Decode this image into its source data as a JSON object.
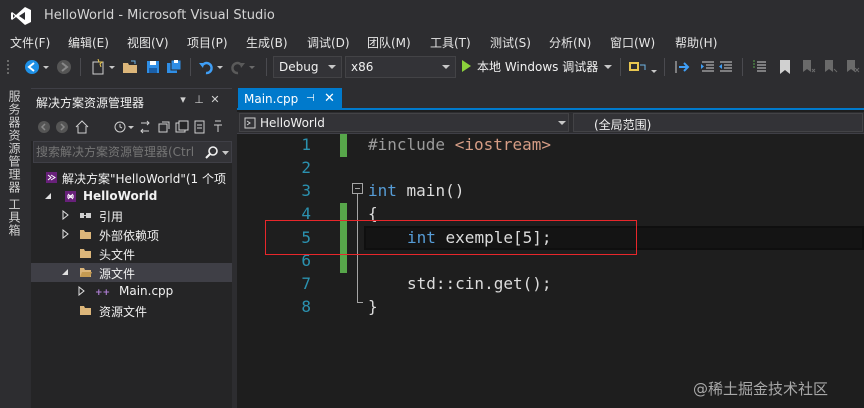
{
  "window": {
    "title": "HelloWorld - Microsoft Visual Studio"
  },
  "menu": [
    "文件(F)",
    "编辑(E)",
    "视图(V)",
    "项目(P)",
    "生成(B)",
    "调试(D)",
    "团队(M)",
    "工具(T)",
    "测试(S)",
    "分析(N)",
    "窗口(W)",
    "帮助(H)"
  ],
  "toolbar": {
    "config": "Debug",
    "platform": "x86",
    "run_label": "本地 Windows 调试器"
  },
  "left_tabs": [
    "服务器资源管理器",
    "工具箱"
  ],
  "solution_explorer": {
    "title": "解决方案资源管理器",
    "search_placeholder": "搜索解决方案资源管理器(Ctrl",
    "tree": [
      {
        "label": "解决方案\"HelloWorld\"(1 个项",
        "icon": "solution-icon",
        "expanded": true
      },
      {
        "label": "HelloWorld",
        "icon": "project-icon",
        "expanded": true,
        "bold": true
      },
      {
        "label": "引用",
        "icon": "references-icon",
        "expanded": false
      },
      {
        "label": "外部依赖项",
        "icon": "folder-icon",
        "expanded": false
      },
      {
        "label": "头文件",
        "icon": "folder-icon"
      },
      {
        "label": "源文件",
        "icon": "folder-icon",
        "expanded": true,
        "selected": true
      },
      {
        "label": "Main.cpp",
        "icon": "cpp-file-icon",
        "expanded": false
      },
      {
        "label": "资源文件",
        "icon": "folder-icon"
      }
    ]
  },
  "editor": {
    "tab": {
      "label": "Main.cpp",
      "pin": "⊣",
      "close": "✕"
    },
    "nav_project": "HelloWorld",
    "nav_scope": "(全局范围)",
    "line_numbers": [
      "1",
      "2",
      "3",
      "4",
      "5",
      "6",
      "7",
      "8"
    ],
    "code": {
      "l1_directive": "#include",
      "l1_header": "<iostream>",
      "l3_kw": "int",
      "l3_rest": " main()",
      "l4": "{",
      "l5_kw": "int",
      "l5_rest": " exemple[5];",
      "l7": "std::cin.get();",
      "l8": "}"
    }
  },
  "colors": {
    "accent": "#007acc",
    "line_number": "#2b91af",
    "keyword": "#569cd6",
    "string": "#d69d85",
    "change_bar": "#57a64a",
    "highlight_box": "#e8272b"
  },
  "watermark": "@稀土掘金技术社区"
}
